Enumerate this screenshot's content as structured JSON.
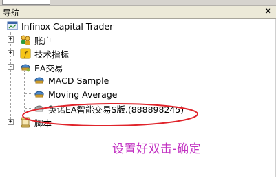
{
  "window": {
    "title": "导航",
    "close_label": "×"
  },
  "tree": {
    "root": {
      "label": "Infinox Capital Trader",
      "icon": "trader-app-icon"
    },
    "items": [
      {
        "label": "账户",
        "icon": "accounts-icon",
        "expander": "+"
      },
      {
        "label": "技术指标",
        "icon": "indicator-icon",
        "expander": "+"
      },
      {
        "label": "EA交易",
        "icon": "expert-advisor-icon",
        "expander": "-"
      },
      {
        "label": "MACD Sample",
        "icon": "expert-icon"
      },
      {
        "label": "Moving Average",
        "icon": "expert-icon"
      },
      {
        "label": "英诺EA智能交易S版.(888898245)",
        "icon": "expert-icon"
      },
      {
        "label": "脚本",
        "icon": "script-icon",
        "expander": "+"
      }
    ]
  },
  "annotation": {
    "text": "设置好双击-确定",
    "color": "#c231c2",
    "ellipse_color": "#e0242b"
  }
}
